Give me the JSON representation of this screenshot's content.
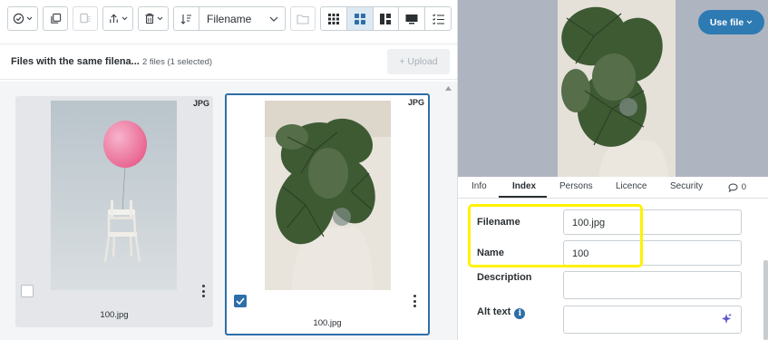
{
  "toolbar": {
    "sort_field": "Filename"
  },
  "info_bar": {
    "title": "Files with the same filena...",
    "count": "2 files (1 selected)",
    "upload_label": "+ Upload"
  },
  "cards": [
    {
      "badge": "JPG",
      "filename": "100.jpg",
      "checked": false
    },
    {
      "badge": "JPG",
      "filename": "100.jpg",
      "checked": true
    }
  ],
  "preview": {
    "use_file_label": "Use file"
  },
  "tabs": [
    {
      "label": "Info",
      "active": false
    },
    {
      "label": "Index",
      "active": true
    },
    {
      "label": "Persons",
      "active": false
    },
    {
      "label": "Licence",
      "active": false
    },
    {
      "label": "Security",
      "active": false
    }
  ],
  "comments_count": "0",
  "fields": [
    {
      "label": "Filename",
      "value": "100.jpg"
    },
    {
      "label": "Name",
      "value": "100"
    },
    {
      "label": "Description",
      "value": ""
    },
    {
      "label": "Alt text",
      "value": "",
      "info_glyph": "i"
    }
  ],
  "colors": {
    "accent": "#2e6ea8",
    "use_file": "#2e7ab3",
    "highlight": "#fff200",
    "preview_bg": "#aeb5c0"
  }
}
